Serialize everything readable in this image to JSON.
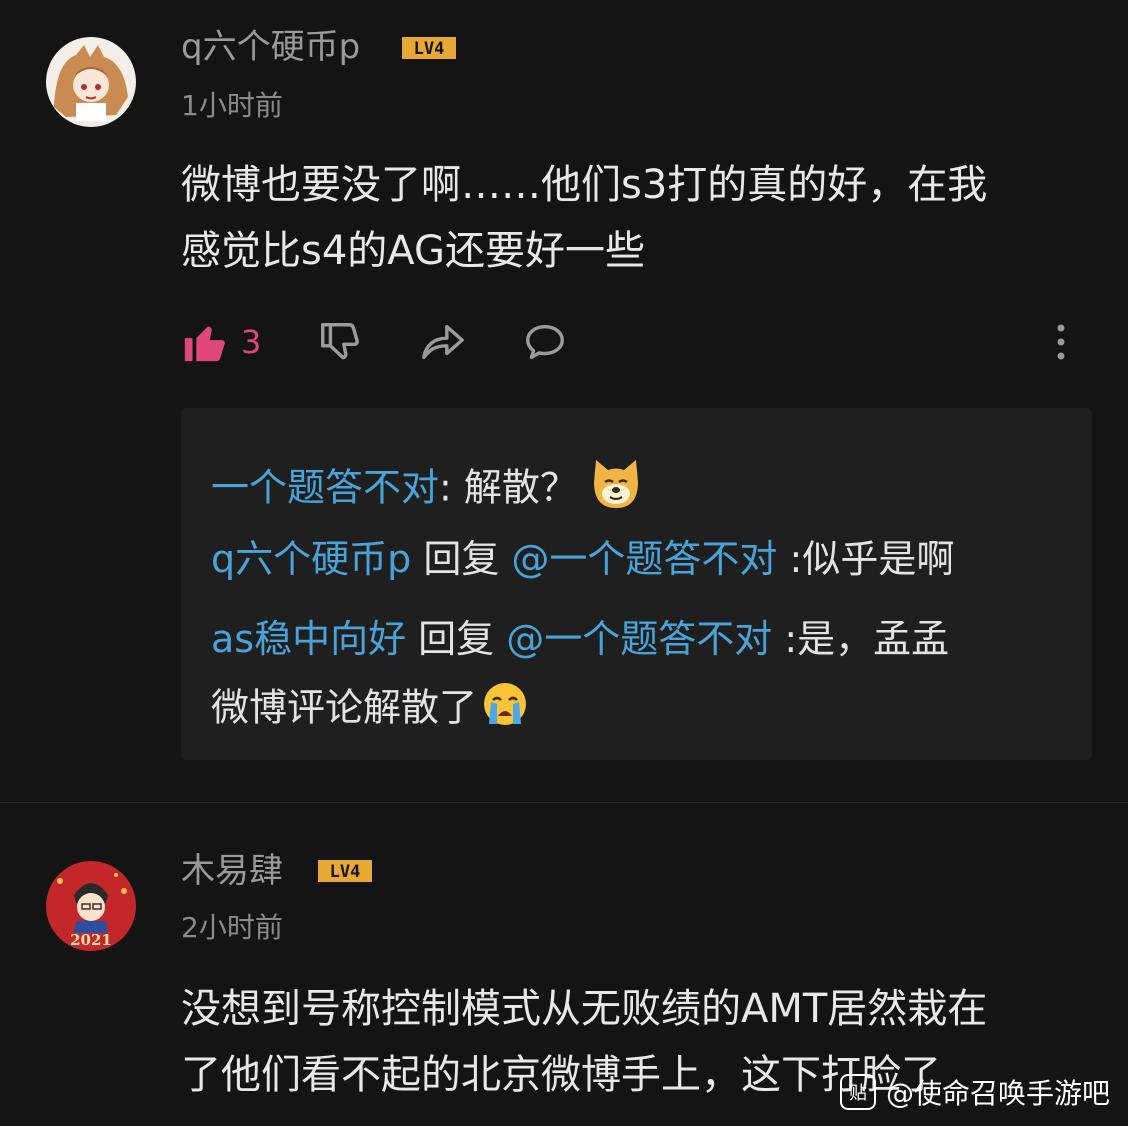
{
  "comments": [
    {
      "username": "q六个硬币p",
      "level": "LV4",
      "time": "1小时前",
      "body_line1": "微博也要没了啊……他们s3打的真的好，在我",
      "body_line2": "感觉比s4的AG还要好一些",
      "likes": "3",
      "replies": [
        {
          "author": "一个题答不对",
          "text": ": 解散？",
          "emoji": "doge-emoji"
        },
        {
          "author": "q六个硬币p",
          "reply_word": " 回复 ",
          "mention": "@一个题答不对",
          "text": " :似乎是啊"
        },
        {
          "author": "as稳中向好",
          "reply_word": " 回复 ",
          "mention": "@一个题答不对",
          "text": " :是，孟孟",
          "text_line2": "微博评论解散了",
          "emoji": "crying-emoji"
        }
      ]
    },
    {
      "username": "木易肆",
      "level": "LV4",
      "time": "2小时前",
      "avatar_text": "2021",
      "body_line1": "没想到号称控制模式从无败绩的AMT居然栽在",
      "body_line2": "了他们看不起的北京微博手上，这下打脸了"
    }
  ],
  "watermark": {
    "badge": "贴",
    "text": "@使命召唤手游吧"
  },
  "colors": {
    "accent_like": "#e0487a",
    "link_blue": "#4aa3d8",
    "level_badge": "#e7a933"
  }
}
